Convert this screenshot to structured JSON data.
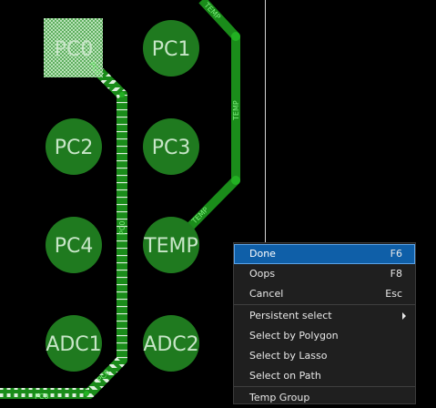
{
  "board": {
    "pads": [
      {
        "label": "PC0",
        "shape": "square"
      },
      {
        "label": "PC1",
        "shape": "circle"
      },
      {
        "label": "PC2",
        "shape": "circle"
      },
      {
        "label": "PC3",
        "shape": "circle"
      },
      {
        "label": "PC4",
        "shape": "circle"
      },
      {
        "label": "TEMP",
        "shape": "circle"
      },
      {
        "label": "ADC1",
        "shape": "circle"
      },
      {
        "label": "ADC2",
        "shape": "circle"
      }
    ],
    "trace_labels": {
      "temp_top": "TEMP",
      "temp_mid": "TEMP",
      "temp_low": "TEMP",
      "pc0_top": "PC0",
      "pc0_mid": "PC0",
      "pc0_diag": "PC0",
      "pc0_bottom": "PC0"
    },
    "colors": {
      "pad": "#1f7a1f",
      "trace": "#1a8c1a",
      "selected_pattern": "#9fd89f",
      "background": "#000000"
    }
  },
  "context_menu": {
    "items": [
      {
        "label": "Done",
        "shortcut": "F6"
      },
      {
        "label": "Oops",
        "shortcut": "F8"
      },
      {
        "label": "Cancel",
        "shortcut": "Esc"
      },
      {
        "label": "Persistent select",
        "shortcut": ""
      },
      {
        "label": "Select by Polygon",
        "shortcut": ""
      },
      {
        "label": "Select by Lasso",
        "shortcut": ""
      },
      {
        "label": "Select on Path",
        "shortcut": ""
      },
      {
        "label": "Temp Group",
        "shortcut": ""
      }
    ],
    "highlight_color": "#0f5fa8"
  }
}
